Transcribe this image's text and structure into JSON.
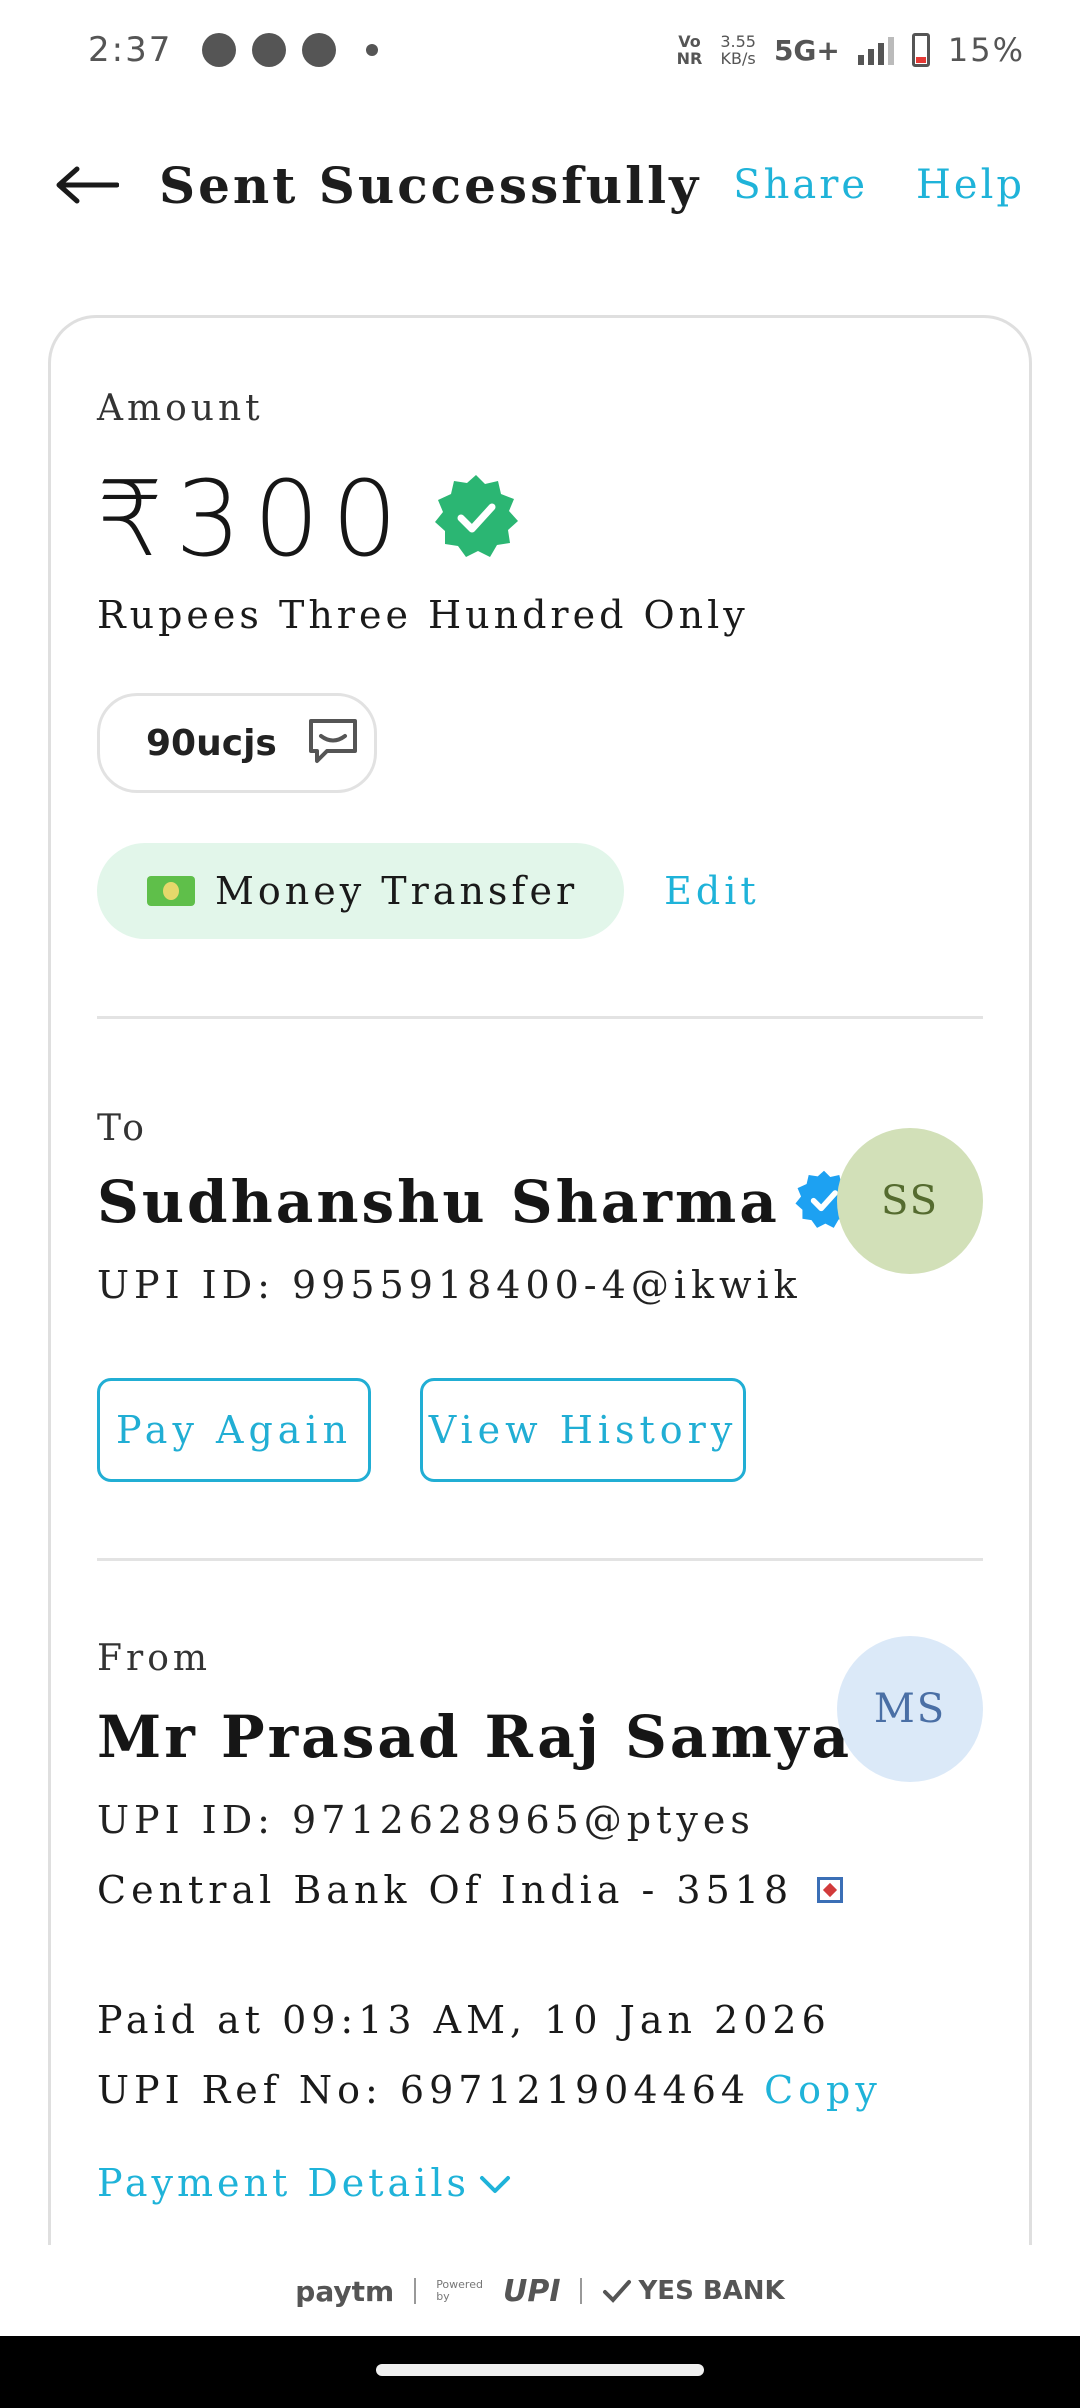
{
  "status_bar": {
    "time": "2:37",
    "net_top": "Vo",
    "net_bottom": "NR",
    "speed_value": "3.55",
    "speed_unit": "KB/s",
    "network": "5G+",
    "battery": "15%"
  },
  "header": {
    "title": "Sent Successfully",
    "share_label": "Share",
    "help_label": "Help"
  },
  "amount": {
    "label": "Amount",
    "value": "₹300",
    "words": "Rupees Three Hundred Only"
  },
  "note": {
    "text": "90ucjs"
  },
  "category": {
    "label": "Money Transfer",
    "edit_label": "Edit"
  },
  "to": {
    "label": "To",
    "name": "Sudhanshu Sharma",
    "upi_id": "UPI ID: 9955918400-4@ikwik",
    "avatar_initials": "SS",
    "pay_again_label": "Pay Again",
    "view_history_label": "View History"
  },
  "from": {
    "label": "From",
    "name": "Mr Prasad Raj Samyadin",
    "upi_id": "UPI ID: 9712628965@ptyes",
    "bank": "Central Bank Of India - 3518",
    "avatar_initials": "MS"
  },
  "transaction": {
    "paid_at": "Paid at 09:13 AM, 10 Jan 2026",
    "ref_no": "UPI Ref No: 697121904464",
    "copy_label": "Copy",
    "details_label": "Payment Details"
  },
  "footer": {
    "paytm": "paytm",
    "powered_line1": "Powered",
    "powered_line2": "by",
    "upi": "UPI",
    "bank": "YES BANK"
  },
  "colors": {
    "accent": "#1fb3d9",
    "success": "#2bb673",
    "verified_blue": "#1da1f2",
    "chip_bg": "#e2f6ea"
  }
}
